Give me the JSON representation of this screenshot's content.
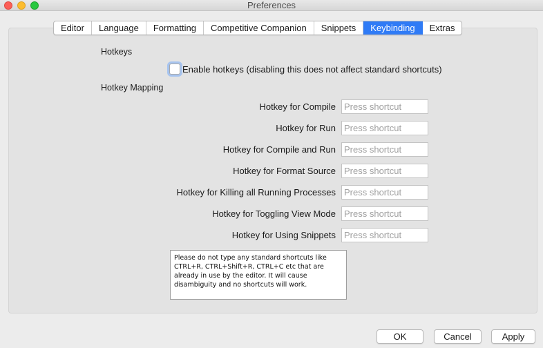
{
  "window": {
    "title": "Preferences"
  },
  "tabs": [
    {
      "label": "Editor",
      "active": false
    },
    {
      "label": "Language",
      "active": false
    },
    {
      "label": "Formatting",
      "active": false
    },
    {
      "label": "Competitive Companion",
      "active": false
    },
    {
      "label": "Snippets",
      "active": false
    },
    {
      "label": "Keybinding",
      "active": true
    },
    {
      "label": "Extras",
      "active": false
    }
  ],
  "keybinding": {
    "section_hotkeys": "Hotkeys",
    "enable_checkbox": {
      "label": "Enable hotkeys (disabling this does not affect standard shortcuts)",
      "checked": false
    },
    "section_mapping": "Hotkey Mapping",
    "placeholder": "Press shortcut",
    "rows": [
      {
        "label": "Hotkey for Compile",
        "value": ""
      },
      {
        "label": "Hotkey for Run",
        "value": ""
      },
      {
        "label": "Hotkey for Compile and Run",
        "value": ""
      },
      {
        "label": "Hotkey for Format Source",
        "value": ""
      },
      {
        "label": "Hotkey for Killing all Running Processes",
        "value": ""
      },
      {
        "label": "Hotkey for Toggling View Mode",
        "value": ""
      },
      {
        "label": "Hotkey for Using Snippets",
        "value": ""
      }
    ],
    "note": "Please do not type any standard shortcuts like\nCTRL+R, CTRL+Shift+R, CTRL+C etc that are\nalready in use by the editor. It will cause\ndisambiguity and no shortcuts will work."
  },
  "buttons": {
    "ok": "OK",
    "cancel": "Cancel",
    "apply": "Apply"
  },
  "colors": {
    "accent": "#2f7bf6",
    "focus_ring": "#a7c4ef",
    "panel": "#e3e3e3",
    "window": "#ececec"
  }
}
